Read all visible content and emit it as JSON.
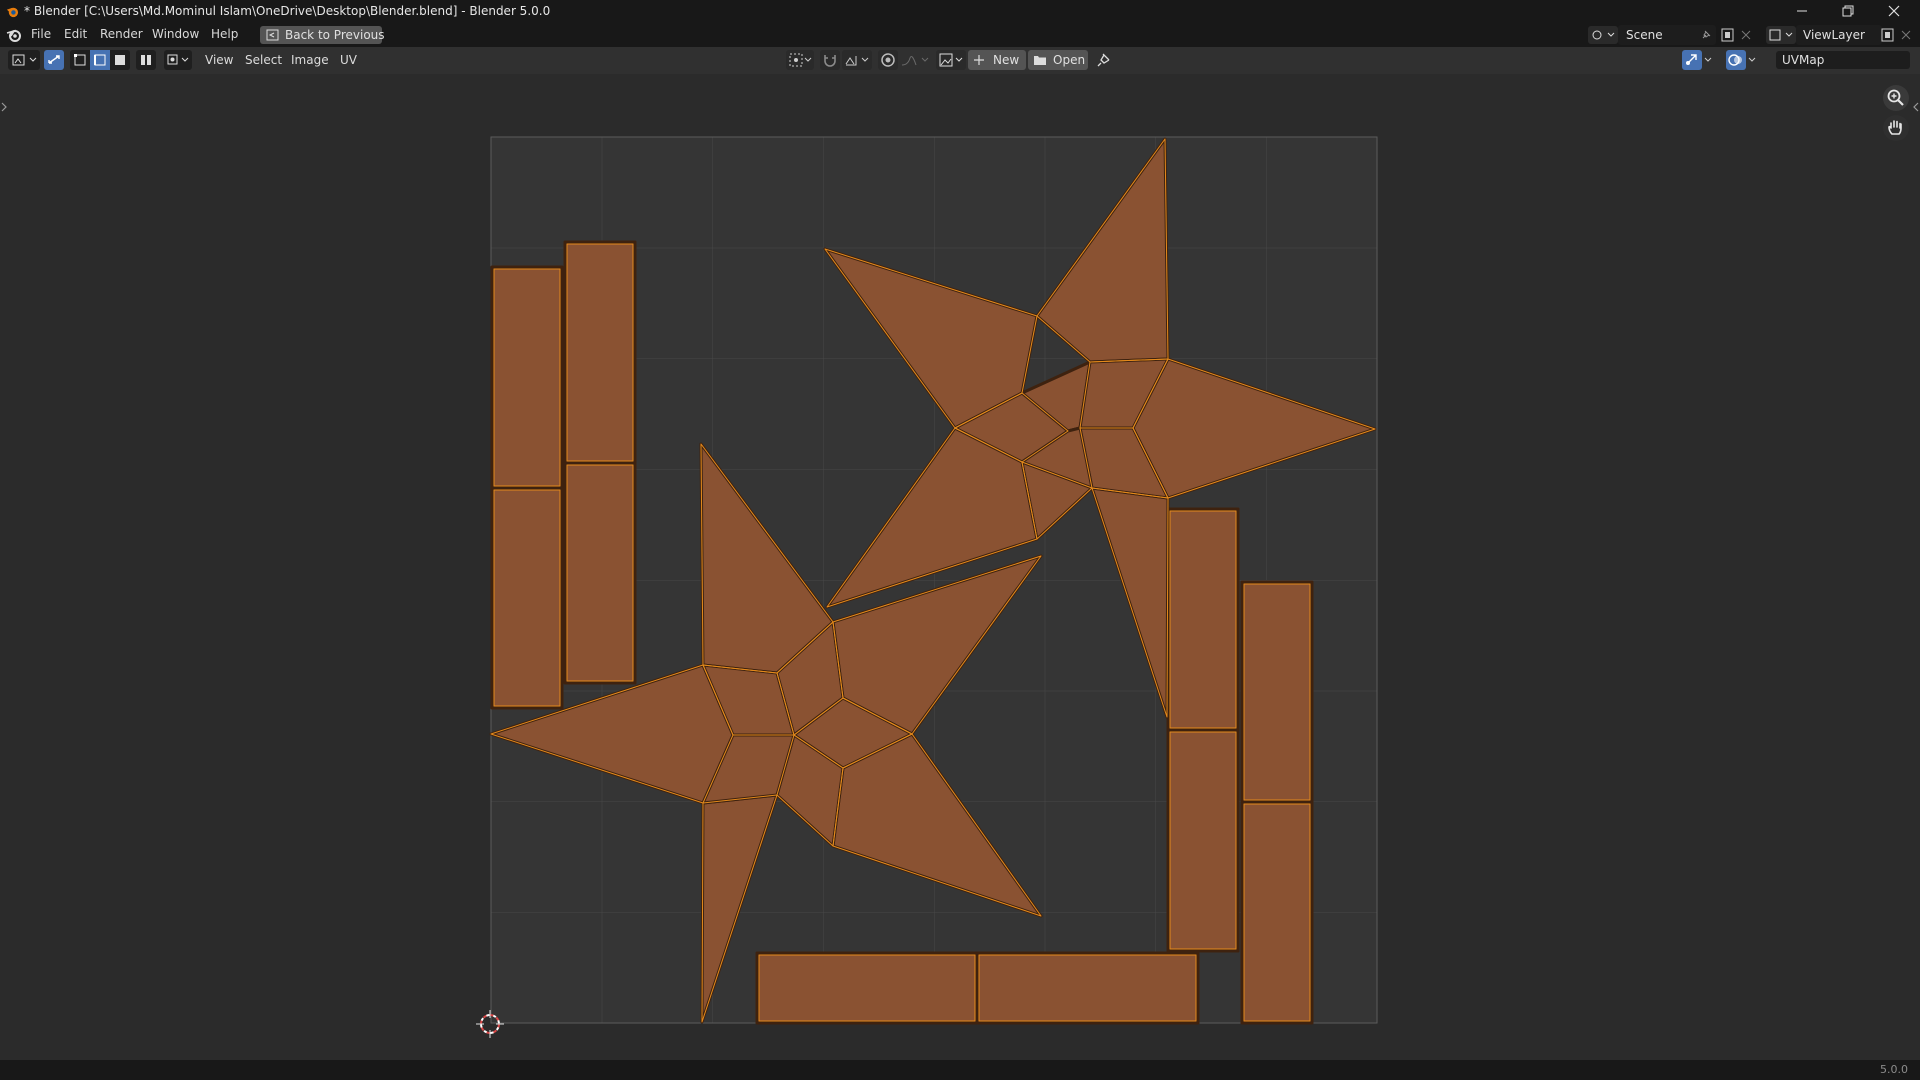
{
  "window": {
    "title": "* Blender [C:\\Users\\Md.Mominul Islam\\OneDrive\\Desktop\\Blender.blend] - Blender 5.0.0"
  },
  "menubar": {
    "items": [
      "File",
      "Edit",
      "Render",
      "Window",
      "Help"
    ],
    "back_button": "Back to Previous",
    "scene": "Scene",
    "view_layer": "ViewLayer"
  },
  "header": {
    "menus": [
      "View",
      "Select",
      "Image",
      "UV"
    ],
    "new_label": "New",
    "open_label": "Open",
    "uv_map": "UVMap"
  },
  "status": {
    "version": "5.0.0"
  },
  "icons": {
    "zoom": "zoom-icon",
    "pan": "hand-pan-icon",
    "cursor": "2d-cursor-icon"
  },
  "colors": {
    "uv_face_fill": "#8a5232",
    "uv_edge": "#e48a1c",
    "uv_edge_dark": "#3e220f",
    "grid_bg": "#353535",
    "grid_line": "#4a4a4a",
    "active_blue": "#4772b3"
  }
}
